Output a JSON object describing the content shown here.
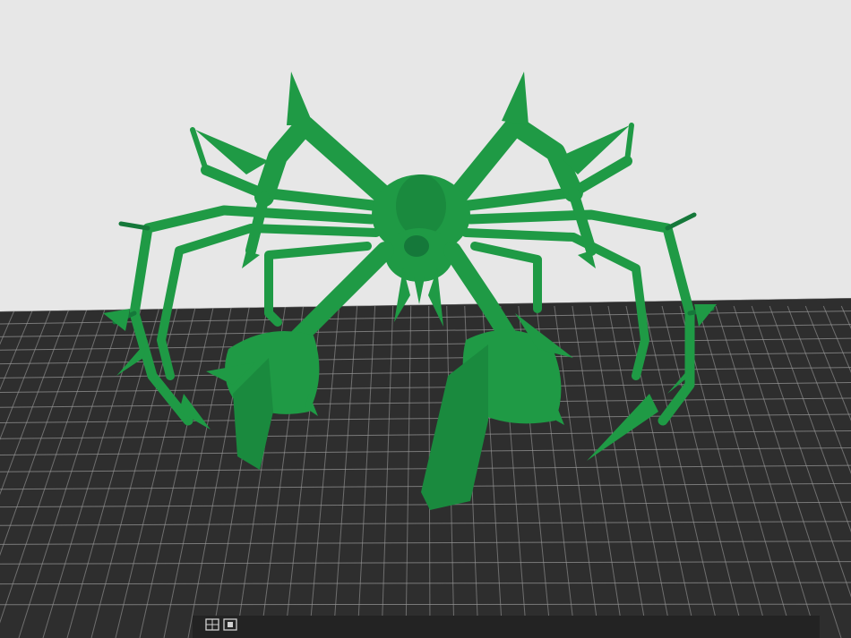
{
  "viewport": {
    "background_color": "#e7e7e7",
    "bed_color": "#2e2e2e",
    "grid_color": "#9a9a9a",
    "model_color": "#1f9a45",
    "model_shadow_color": "#15783a",
    "bed_icons": [
      "grid-icon",
      "cube-icon"
    ]
  }
}
